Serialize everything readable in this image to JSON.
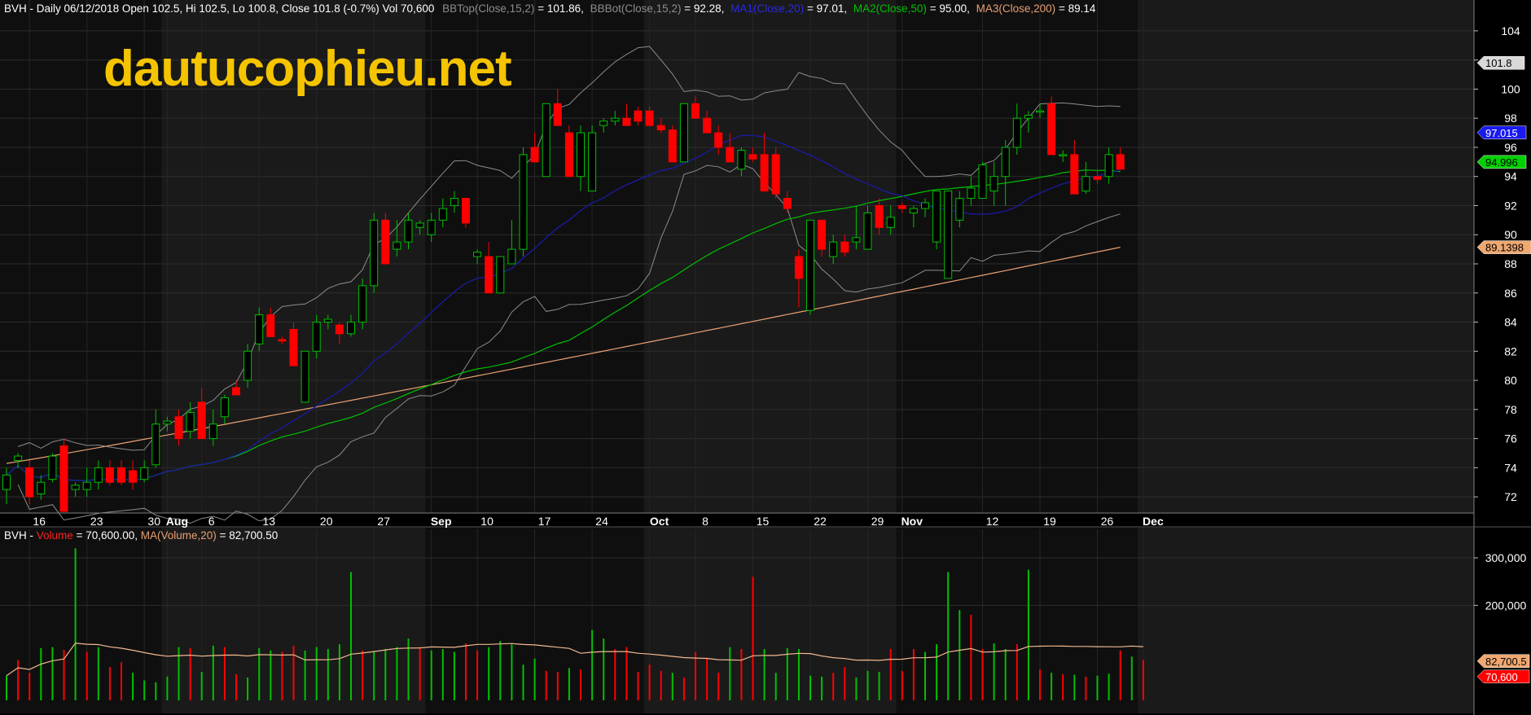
{
  "header": {
    "symbol": "BVH",
    "price_text": "BVH - Daily 06/12/2018 Open 102.5, Hi 102.5, Lo 100.8, Close 101.8 (-0.7%) Vol 70,600",
    "bbtop_label": "BBTop(Close,15,2)",
    "bbtop_value": " = 101.86,",
    "bbbot_label": "BBBot(Close,15,2)",
    "bbbot_value": " = 92.28,",
    "ma1_label": "MA1(Close,20)",
    "ma1_value": " = 97.01,",
    "ma2_label": "MA2(Close,50)",
    "ma2_value": " = 95.00,",
    "ma3_label": "MA3(Close,200)",
    "ma3_value": " = 89.14"
  },
  "volume_header": {
    "prefix": "BVH - ",
    "volume_label": "Volume",
    "volume_value": " = 70,600.00, ",
    "ma_label": "MA(Volume,20)",
    "ma_value": " = 82,700.50"
  },
  "watermark": "dautucophieu.net",
  "colors": {
    "up": "#00c000",
    "down": "#ff0000",
    "ma1": "#1a1aa6",
    "ma2": "#00c000",
    "ma3": "#e8a070",
    "bollinger": "#8c8c8c",
    "vol_ma": "#f0b890",
    "watermark": "#f5c400"
  },
  "badges": {
    "last_price": "101.8",
    "ma1": "97.015",
    "ma2": "94.996",
    "ma3": "89.1398",
    "vol_ma": "82,700.5",
    "volume": "70,600"
  },
  "chart_data": [
    {
      "type": "candlestick",
      "title": "BVH - Daily",
      "ylim": [
        71,
        105
      ],
      "y_ticks": [
        72,
        74,
        76,
        78,
        80,
        82,
        84,
        86,
        88,
        90,
        92,
        94,
        96,
        98,
        100,
        102,
        104
      ],
      "x_labels": [
        {
          "label": "16",
          "index": 2,
          "bold": false
        },
        {
          "label": "23",
          "index": 7,
          "bold": false
        },
        {
          "label": "30",
          "index": 12,
          "bold": false
        },
        {
          "label": "Aug",
          "index": 14,
          "bold": true
        },
        {
          "label": "6",
          "index": 17,
          "bold": false
        },
        {
          "label": "13",
          "index": 22,
          "bold": false
        },
        {
          "label": "20",
          "index": 27,
          "bold": false
        },
        {
          "label": "27",
          "index": 32,
          "bold": false
        },
        {
          "label": "Sep",
          "index": 37,
          "bold": true
        },
        {
          "label": "10",
          "index": 41,
          "bold": false
        },
        {
          "label": "17",
          "index": 46,
          "bold": false
        },
        {
          "label": "24",
          "index": 51,
          "bold": false
        },
        {
          "label": "Oct",
          "index": 56,
          "bold": true
        },
        {
          "label": "8",
          "index": 60,
          "bold": false
        },
        {
          "label": "15",
          "index": 65,
          "bold": false
        },
        {
          "label": "22",
          "index": 70,
          "bold": false
        },
        {
          "label": "29",
          "index": 75,
          "bold": false
        },
        {
          "label": "Nov",
          "index": 78,
          "bold": true
        },
        {
          "label": "12",
          "index": 85,
          "bold": false
        },
        {
          "label": "19",
          "index": 90,
          "bold": false
        },
        {
          "label": "26",
          "index": 95,
          "bold": false
        },
        {
          "label": "Dec",
          "index": 99,
          "bold": true
        }
      ],
      "ohlc": [
        [
          72.5,
          74,
          71.5,
          73.5
        ],
        [
          74.5,
          75,
          74,
          74.8
        ],
        [
          74,
          74.5,
          71.5,
          72
        ],
        [
          72.2,
          73.5,
          71.8,
          73
        ],
        [
          73.2,
          75,
          73,
          74.8
        ],
        [
          75.5,
          76,
          71,
          71
        ],
        [
          72.5,
          73,
          72,
          72.8
        ],
        [
          72.5,
          74,
          72,
          73
        ],
        [
          73,
          74.5,
          72.5,
          74
        ],
        [
          74,
          74.5,
          72.8,
          73
        ],
        [
          74,
          74.5,
          72.8,
          73
        ],
        [
          73.8,
          74.5,
          72.5,
          73
        ],
        [
          73.2,
          74.5,
          73,
          74
        ],
        [
          74.2,
          78,
          74,
          77
        ],
        [
          77,
          77.5,
          76.5,
          77.2
        ],
        [
          77.5,
          78,
          75.5,
          76
        ],
        [
          76.5,
          78.5,
          76,
          77.8
        ],
        [
          78.5,
          79.5,
          76,
          76
        ],
        [
          76,
          78,
          75.5,
          77
        ],
        [
          77.5,
          79,
          77,
          78.8
        ],
        [
          79.5,
          80,
          79,
          79
        ],
        [
          80,
          82.5,
          79.5,
          82
        ],
        [
          82.5,
          85,
          82,
          84.5
        ],
        [
          84.5,
          85,
          83,
          83
        ],
        [
          82.8,
          83,
          82.5,
          82.7
        ],
        [
          83.5,
          84,
          81,
          81
        ],
        [
          78.5,
          82,
          78.5,
          82
        ],
        [
          82,
          84.5,
          81.5,
          84
        ],
        [
          84,
          84.5,
          83.5,
          84.2
        ],
        [
          83.8,
          84,
          82.5,
          83.2
        ],
        [
          83.2,
          84.5,
          83,
          84
        ],
        [
          84,
          87,
          83.5,
          86.5
        ],
        [
          86.5,
          91.5,
          86,
          91
        ],
        [
          91,
          91.5,
          88,
          88
        ],
        [
          89,
          91,
          88.5,
          89.5
        ],
        [
          89.5,
          91.5,
          89,
          91
        ],
        [
          90.5,
          91,
          90,
          90.8
        ],
        [
          90,
          91.5,
          89.5,
          91
        ],
        [
          91,
          92.5,
          90.5,
          91.8
        ],
        [
          92,
          93,
          91.5,
          92.5
        ],
        [
          92.5,
          92.5,
          90.5,
          90.8
        ],
        [
          88.5,
          89,
          88,
          88.8
        ],
        [
          88.5,
          89.5,
          86,
          86
        ],
        [
          86,
          88.5,
          86,
          88.5
        ],
        [
          88,
          91,
          88,
          89
        ],
        [
          89,
          96,
          88.5,
          95.5
        ],
        [
          96,
          97,
          95,
          95
        ],
        [
          94,
          99,
          94,
          99
        ],
        [
          99,
          100,
          98.5,
          97.5
        ],
        [
          97,
          97.5,
          94,
          94
        ],
        [
          94,
          97.5,
          93,
          97
        ],
        [
          93,
          97.5,
          93,
          97
        ],
        [
          97.5,
          98,
          97,
          97.8
        ],
        [
          97.8,
          98.5,
          97.5,
          98
        ],
        [
          98,
          99,
          97.5,
          97.5
        ],
        [
          98.5,
          98.8,
          97.5,
          97.8
        ],
        [
          98.5,
          98.8,
          97.5,
          97.5
        ],
        [
          97.5,
          98,
          97,
          97.2
        ],
        [
          97.2,
          97.5,
          95,
          95
        ],
        [
          95,
          99,
          95,
          99
        ],
        [
          99,
          99.5,
          98,
          98
        ],
        [
          98,
          98.5,
          97,
          97
        ],
        [
          97,
          97.5,
          95.5,
          96
        ],
        [
          96,
          97,
          95,
          95
        ],
        [
          94.5,
          96,
          94,
          95.8
        ],
        [
          95.5,
          96,
          95,
          95.2
        ],
        [
          95.5,
          97,
          93,
          93
        ],
        [
          95.5,
          96,
          92.5,
          92.8
        ],
        [
          92.5,
          93,
          91.5,
          91.8
        ],
        [
          88.5,
          89,
          85,
          87
        ],
        [
          84.8,
          91,
          84.5,
          91
        ],
        [
          91,
          91,
          88.5,
          89
        ],
        [
          88.5,
          90,
          88,
          89.5
        ],
        [
          89.5,
          90,
          88.5,
          88.8
        ],
        [
          89.5,
          92,
          89,
          89.8
        ],
        [
          89,
          92,
          89,
          91.5
        ],
        [
          92,
          92.5,
          90,
          90.5
        ],
        [
          90.5,
          92,
          90,
          91.2
        ],
        [
          92,
          92.2,
          91.5,
          91.8
        ],
        [
          91.5,
          92,
          90.5,
          91.8
        ],
        [
          91.8,
          92.5,
          91.2,
          92.2
        ],
        [
          89.5,
          93,
          89,
          93
        ],
        [
          87,
          93,
          87,
          93
        ],
        [
          91,
          93,
          90.5,
          92.5
        ],
        [
          92.5,
          94,
          92,
          93.2
        ],
        [
          92.5,
          95,
          92.5,
          94.8
        ],
        [
          93,
          95,
          92,
          94
        ],
        [
          94,
          96.5,
          92,
          96
        ],
        [
          96,
          99,
          95.5,
          98
        ],
        [
          98,
          98.5,
          97,
          98.2
        ],
        [
          98.5,
          99,
          98,
          98.5
        ],
        [
          99,
          99.5,
          98,
          95.5
        ],
        [
          95.5,
          95.8,
          95,
          95.5
        ],
        [
          95.5,
          96.5,
          92.8,
          92.8
        ],
        [
          93,
          95,
          92.8,
          94
        ],
        [
          94,
          94.5,
          93.5,
          93.8
        ],
        [
          94,
          96,
          93.5,
          95.5
        ],
        [
          95.5,
          96,
          95,
          94.5
        ]
      ]
    },
    {
      "type": "bar",
      "title": "Volume",
      "ylim": [
        0,
        360000
      ],
      "y_ticks": [
        200000,
        300000
      ],
      "y_tick_labels": [
        "200,000",
        "300,000"
      ],
      "values": [
        52000,
        85000,
        58000,
        110000,
        112000,
        106000,
        320000,
        102000,
        112000,
        70000,
        80000,
        58000,
        42000,
        38000,
        50000,
        112000,
        110000,
        60000,
        115000,
        112000,
        55000,
        48000,
        110000,
        105000,
        102000,
        115000,
        105000,
        112000,
        108000,
        118000,
        270000,
        105000,
        102000,
        108000,
        112000,
        130000,
        112000,
        105000,
        108000,
        102000,
        120000,
        105000,
        112000,
        125000,
        118000,
        75000,
        88000,
        62000,
        60000,
        68000,
        65000,
        148000,
        130000,
        108000,
        112000,
        60000,
        75000,
        62000,
        58000,
        48000,
        102000,
        90000,
        58000,
        112000,
        108000,
        260000,
        108000,
        58000,
        110000,
        108000,
        52000,
        50000,
        58000,
        70000,
        48000,
        62000,
        60000,
        108000,
        62000,
        108000,
        102000,
        118000,
        270000,
        190000,
        180000,
        108000,
        120000,
        108000,
        118000,
        275000,
        65000,
        58000,
        55000,
        54000,
        50000,
        52000,
        56000,
        105000,
        92000,
        85000
      ],
      "colors": [
        "up",
        "down",
        "down",
        "up",
        "up",
        "down",
        "up",
        "down",
        "up",
        "down",
        "down",
        "up",
        "up",
        "up",
        "up",
        "up",
        "down",
        "up",
        "up",
        "down",
        "down",
        "up",
        "up",
        "up",
        "down",
        "down",
        "up",
        "up",
        "up",
        "up",
        "up",
        "down",
        "up",
        "up",
        "up",
        "up",
        "down",
        "up",
        "up",
        "up",
        "down",
        "down",
        "up",
        "up",
        "up",
        "up",
        "up",
        "down",
        "down",
        "up",
        "down",
        "up",
        "up",
        "down",
        "down",
        "down",
        "down",
        "down",
        "up",
        "down",
        "down",
        "down",
        "down",
        "up",
        "down",
        "down",
        "up",
        "up",
        "up",
        "up",
        "up",
        "up",
        "down",
        "down",
        "up",
        "up",
        "up",
        "down",
        "down",
        "down",
        "up",
        "up",
        "up",
        "up",
        "down",
        "down",
        "up",
        "up",
        "down",
        "up",
        "down",
        "up",
        "down",
        "up",
        "down",
        "up",
        "up",
        "down",
        "up",
        "down"
      ]
    }
  ]
}
